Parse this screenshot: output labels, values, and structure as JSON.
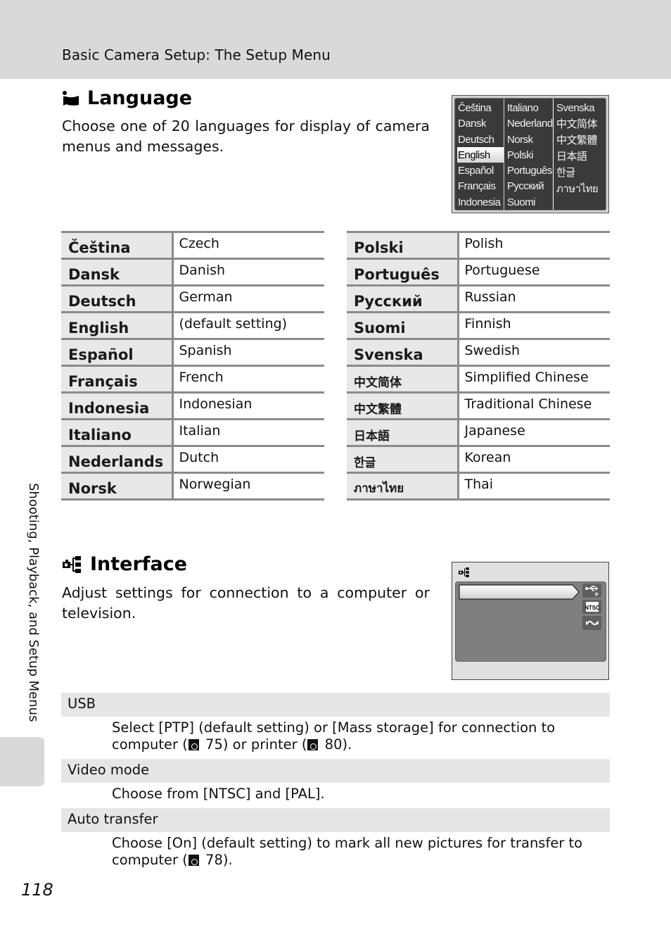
{
  "header": {
    "title": "Basic Camera Setup: The Setup Menu"
  },
  "language_section": {
    "icon": "language-icon",
    "title": "Language",
    "description": "Choose one of 20 languages for display of camera menus and messages.",
    "screen": {
      "columns": [
        [
          "Čeština",
          "Dansk",
          "Deutsch",
          "English",
          "Español",
          "Français",
          "Indonesia"
        ],
        [
          "Italiano",
          "Nederlands",
          "Norsk",
          "Polski",
          "Português",
          "Русский",
          "Suomi"
        ],
        [
          "Svenska",
          "中文简体",
          "中文繁體",
          "日本語",
          "한글",
          "ภาษาไทย"
        ]
      ],
      "selected": "English"
    },
    "table_left": [
      {
        "native": "Čeština",
        "english": "Czech"
      },
      {
        "native": "Dansk",
        "english": "Danish"
      },
      {
        "native": "Deutsch",
        "english": "German"
      },
      {
        "native": "English",
        "english": "(default setting)"
      },
      {
        "native": "Español",
        "english": "Spanish"
      },
      {
        "native": "Français",
        "english": "French"
      },
      {
        "native": "Indonesia",
        "english": "Indonesian"
      },
      {
        "native": "Italiano",
        "english": "Italian"
      },
      {
        "native": "Nederlands",
        "english": "Dutch"
      },
      {
        "native": "Norsk",
        "english": "Norwegian"
      }
    ],
    "table_right": [
      {
        "native": "Polski",
        "english": "Polish"
      },
      {
        "native": "Português",
        "english": "Portuguese"
      },
      {
        "native": "Русский",
        "english": "Russian"
      },
      {
        "native": "Suomi",
        "english": "Finnish"
      },
      {
        "native": "Svenska",
        "english": "Swedish"
      },
      {
        "native": "中文简体",
        "english": "Simplified Chinese"
      },
      {
        "native": "中文繁體",
        "english": "Traditional Chinese"
      },
      {
        "native": "日本語",
        "english": "Japanese"
      },
      {
        "native": "한글",
        "english": "Korean"
      },
      {
        "native": "ภาษาไทย",
        "english": "Thai"
      }
    ]
  },
  "interface_section": {
    "icon": "interface-icon",
    "title": "Interface",
    "description": "Adjust settings for connection to a computer or television.",
    "screen": {
      "icons": [
        "usb-ptp-icon",
        "ntsc-icon",
        "auto-transfer-icon"
      ],
      "ntsc_label": "NTSC",
      "ptp_label": "P"
    },
    "options": [
      {
        "name": "USB",
        "parts": [
          "Select [PTP] (default setting) or [Mass storage] for connection to computer (",
          " 75) or printer (",
          " 80)."
        ]
      },
      {
        "name": "Video mode",
        "parts": [
          "Choose from [NTSC] and [PAL]."
        ]
      },
      {
        "name": "Auto transfer",
        "parts": [
          "Choose [On] (default setting) to mark all new pictures for transfer to computer (",
          " 78)."
        ]
      }
    ]
  },
  "side_tab": {
    "label": "Shooting, Playback, and Setup Menus"
  },
  "page_number": "118"
}
